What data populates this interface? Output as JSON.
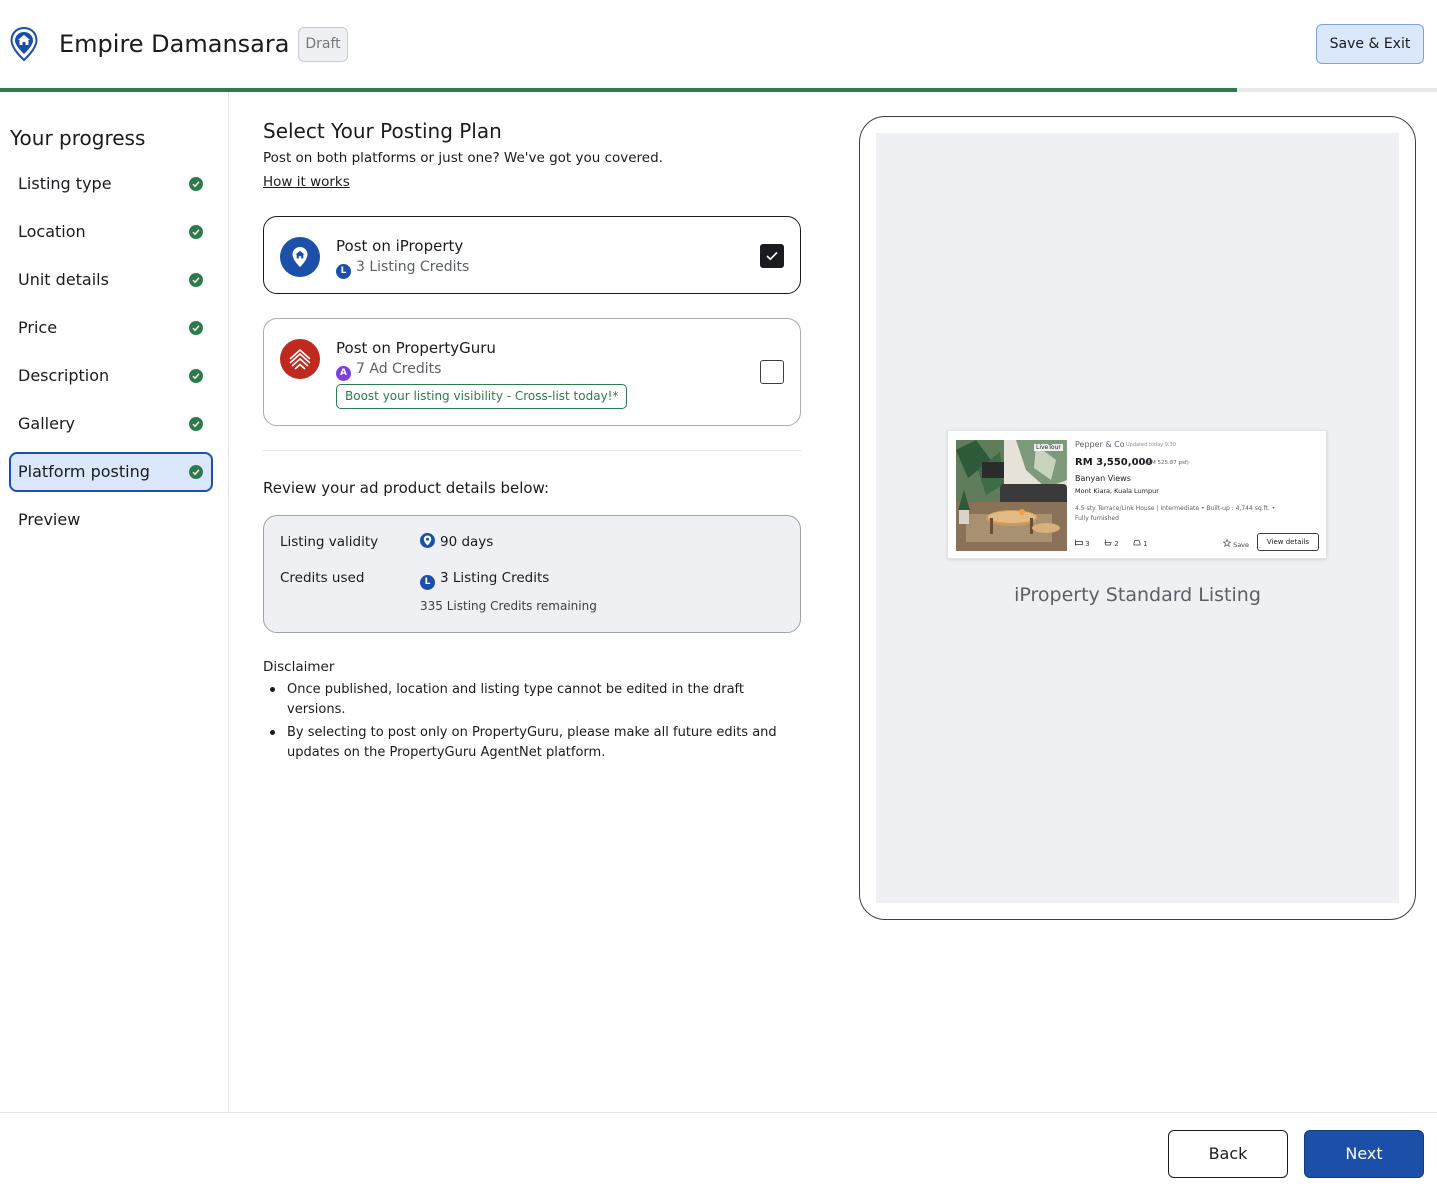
{
  "header": {
    "title": "Empire Damansara",
    "status_badge": "Draft",
    "save_exit_label": "Save & Exit",
    "progress_fraction": 0.861
  },
  "sidebar": {
    "title": "Your progress",
    "steps": [
      {
        "label": "Listing type",
        "completed": true
      },
      {
        "label": "Location",
        "completed": true
      },
      {
        "label": "Unit details",
        "completed": true
      },
      {
        "label": "Price",
        "completed": true
      },
      {
        "label": "Description",
        "completed": true
      },
      {
        "label": "Gallery",
        "completed": true
      },
      {
        "label": "Platform posting",
        "completed": true,
        "active": true
      },
      {
        "label": "Preview",
        "completed": false
      }
    ]
  },
  "main": {
    "title": "Select Your Posting Plan",
    "subtitle": "Post on both platforms or just one? We've got you covered.",
    "how_it_works_link": "How it works",
    "plans": [
      {
        "name": "Post on iProperty",
        "credit_icon": "L",
        "credits": "3 Listing Credits",
        "checked": true
      },
      {
        "name": "Post on PropertyGuru",
        "credit_icon": "A",
        "credits": "7 Ad Credits",
        "checked": false,
        "promo": "Boost your listing visibility - Cross-list today!*"
      }
    ],
    "review_title": "Review your ad product details below:",
    "review": {
      "validity_label": "Listing validity",
      "validity_value": "90 days",
      "credits_label": "Credits used",
      "credits_icon": "L",
      "credits_value": "3 Listing Credits",
      "credits_remaining": "335 Listing Credits remaining"
    },
    "disclaimer_title": "Disclaimer",
    "disclaimer_items": [
      "Once published, location and listing type cannot be edited in the draft versions.",
      "By selecting to post only on PropertyGuru, please make all future edits and updates on the PropertyGuru AgentNet platform."
    ]
  },
  "preview": {
    "card": {
      "live_tour": "LiveTour",
      "agent": "Pepper & Co",
      "updated": "Updated today 9:30",
      "price": "RM 3,550,000",
      "psf": "(RM 525.87 psf)",
      "project": "Banyan Views",
      "address": "Mont Kiara, Kuala Lumpur",
      "specs": "4.5-sty Terrace/Link House | Intermediate  •  Built-up : 4,744 sq.ft.  •",
      "furnishing": "Fully furnished",
      "beds": "3",
      "baths": "2",
      "parking": "1",
      "save_label": "Save",
      "view_label": "View details"
    },
    "caption": "iProperty Standard Listing"
  },
  "footer": {
    "back_label": "Back",
    "next_label": "Next"
  },
  "colors": {
    "accent": "#1c4fa8",
    "success": "#2e7a4c",
    "propertyguru": "#c0291e",
    "ad_credit": "#7b3fe4"
  }
}
